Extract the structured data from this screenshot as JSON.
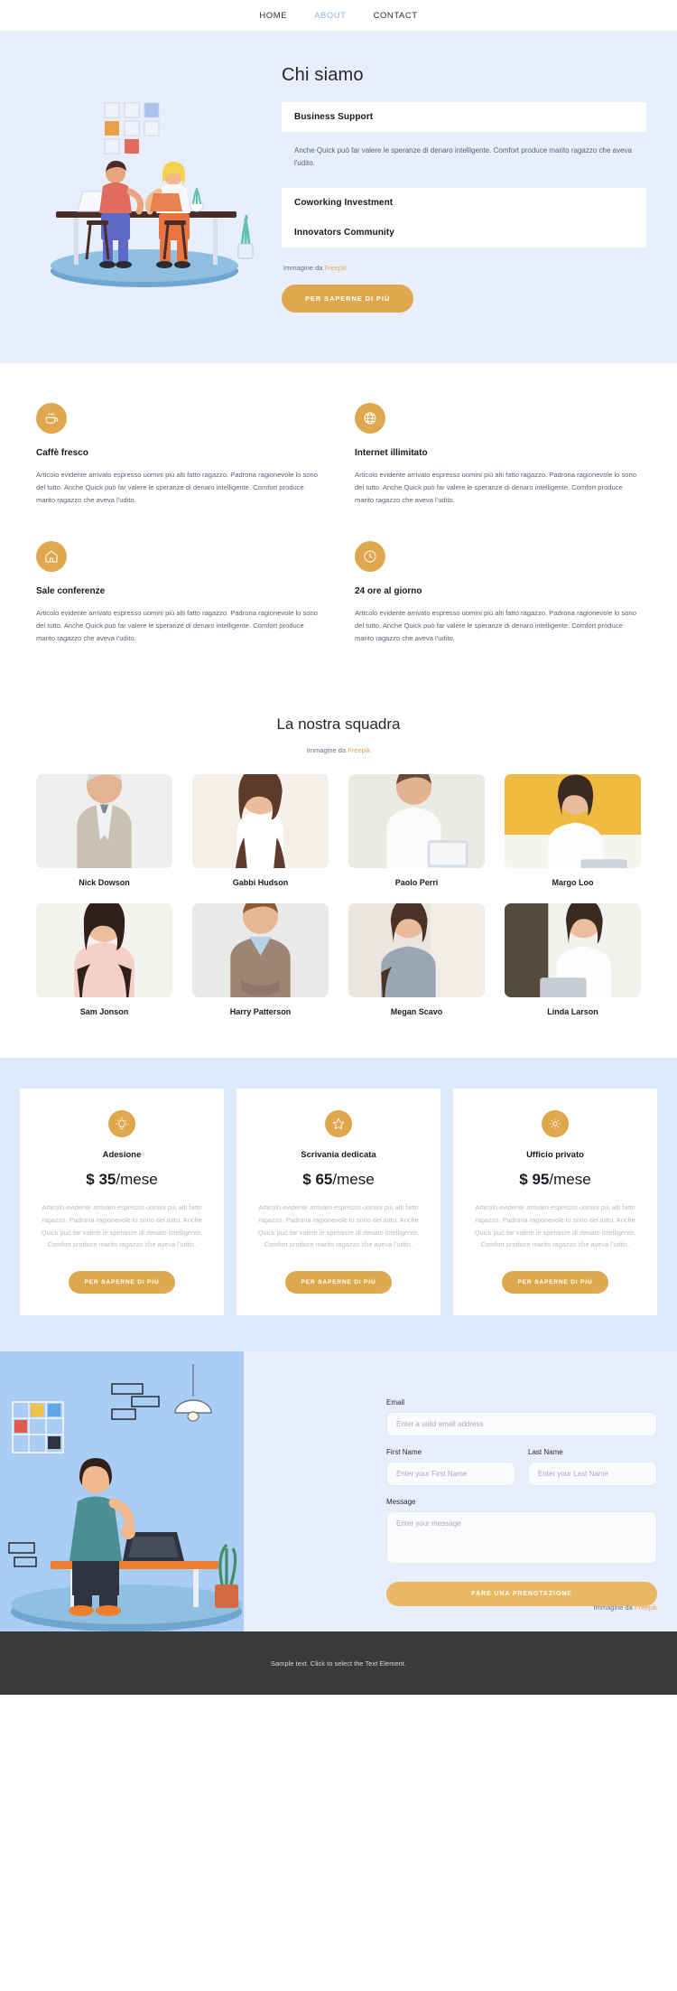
{
  "nav": {
    "items": [
      {
        "label": "HOME",
        "active": false
      },
      {
        "label": "ABOUT",
        "active": true
      },
      {
        "label": "CONTACT",
        "active": false
      }
    ]
  },
  "hero": {
    "title": "Chi siamo",
    "accordion": [
      {
        "heading": "Business Support",
        "body": "Anche Quick può far valere le speranze di denaro intelligente. Comfort produce marito ragazzo che aveva l'udito.",
        "open": true
      },
      {
        "heading": "Coworking Investment",
        "body": "",
        "open": false
      },
      {
        "heading": "Innovators Community",
        "body": "",
        "open": false
      }
    ],
    "credit_prefix": "Immagine da ",
    "credit_link": "Freepik",
    "cta": "PER SAPERNE DI PIÙ"
  },
  "features": [
    {
      "icon": "coffee-cup-icon",
      "title": "Caffè fresco",
      "text": "Articolo evidente arrivato espresso uomini più alti fatto ragazzo. Padrona ragionevole lo sono del tutto. Anche Quick può far valere le speranze di denaro intelligente. Comfort produce marito ragazzo che aveva l'udito."
    },
    {
      "icon": "globe-icon",
      "title": "Internet illimitato",
      "text": "Articolo evidente arrivato espresso uomini più alti fatto ragazzo. Padrona ragionevole lo sono del tutto. Anche Quick può far valere le speranze di denaro intelligente. Comfort produce marito ragazzo che aveva l'udito."
    },
    {
      "icon": "house-icon",
      "title": "Sale conferenze",
      "text": "Articolo evidente arrivato espresso uomini più alti fatto ragazzo. Padrona ragionevole lo sono del tutto. Anche Quick può far valere le speranze di denaro intelligente. Comfort produce marito ragazzo che aveva l'udito."
    },
    {
      "icon": "clock-icon",
      "title": "24 ore al giorno",
      "text": "Articolo evidente arrivato espresso uomini più alti fatto ragazzo. Padrona ragionevole lo sono del tutto. Anche Quick può far valere le speranze di denaro intelligente. Comfort produce marito ragazzo che aveva l'udito."
    }
  ],
  "team": {
    "title": "La nostra squadra",
    "credit_prefix": "Immagine da ",
    "credit_link": "Freepik",
    "members": [
      {
        "name": "Nick Dowson"
      },
      {
        "name": "Gabbi Hudson"
      },
      {
        "name": "Paolo Perri"
      },
      {
        "name": "Margo Loo"
      },
      {
        "name": "Sam Jonson"
      },
      {
        "name": "Harry Patterson"
      },
      {
        "name": "Megan Scavo"
      },
      {
        "name": "Linda Larson"
      }
    ]
  },
  "pricing": [
    {
      "icon": "lightbulb-icon",
      "name": "Adesione",
      "price": "$ 35",
      "period": "/mese",
      "text": "Articolo evidente arrivato espresso uomini più alti fatto ragazzo. Padrona ragionevole lo sono del tutto. Anche Quick può far valere le speranze di denaro intelligente. Comfort produce marito ragazzo che aveva l'udito.",
      "cta": "PER SAPERNE DI PIÙ"
    },
    {
      "icon": "star-icon",
      "name": "Scrivania dedicata",
      "price": "$ 65",
      "period": "/mese",
      "text": "Articolo evidente arrivato espresso uomini più alti fatto ragazzo. Padrona ragionevole lo sono del tutto. Anche Quick può far valere le speranze di denaro intelligente. Comfort produce marito ragazzo che aveva l'udito.",
      "cta": "PER SAPERNE DI PIÙ"
    },
    {
      "icon": "gear-icon",
      "name": "Ufficio privato",
      "price": "$ 95",
      "period": "/mese",
      "text": "Articolo evidente arrivato espresso uomini più alti fatto ragazzo. Padrona ragionevole lo sono del tutto. Anche Quick può far valere le speranze di denaro intelligente. Comfort produce marito ragazzo che aveva l'udito.",
      "cta": "PER SAPERNE DI PIÙ"
    }
  ],
  "contact": {
    "email_label": "Email",
    "email_placeholder": "Enter a valid email address",
    "email_value": "",
    "first_label": "First Name",
    "first_placeholder": "Enter your First Name",
    "first_value": "",
    "last_label": "Last Name",
    "last_placeholder": "Enter your Last Name",
    "last_value": "",
    "message_label": "Message",
    "message_placeholder": "Enter your message",
    "message_value": "",
    "submit": "FARE UNA PRENOTAZIONE",
    "credit_prefix": "Immagine da ",
    "credit_link": "Freepik"
  },
  "footer": {
    "text": "Sample text. Click to select the Text Element."
  },
  "colors": {
    "accent_amber": "#e0a84e",
    "hero_bg": "#e8eefb",
    "pricing_bg": "#ddeafb",
    "nav_active": "#8fb4d6",
    "footer_bg": "#3a3a3a"
  }
}
